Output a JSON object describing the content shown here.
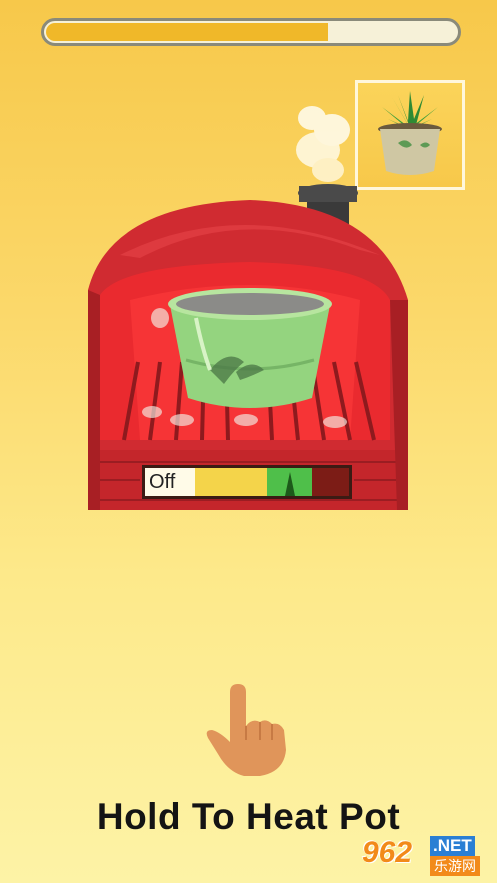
{
  "progress": {
    "fraction": 0.68,
    "color": "#f0b829"
  },
  "heat_meter": {
    "off_label": "Off",
    "needle_zone": "green"
  },
  "instruction": "Hold To Heat Pot",
  "watermark": {
    "number": "962",
    "suffix": ".NET",
    "cn": "乐游网"
  },
  "icons": {
    "hand": "pointing-hand-icon",
    "preview": "finished-pot-preview"
  },
  "colors": {
    "oven": "#c9262c",
    "pot": "#8fd17a",
    "background": "#f9d35c"
  }
}
